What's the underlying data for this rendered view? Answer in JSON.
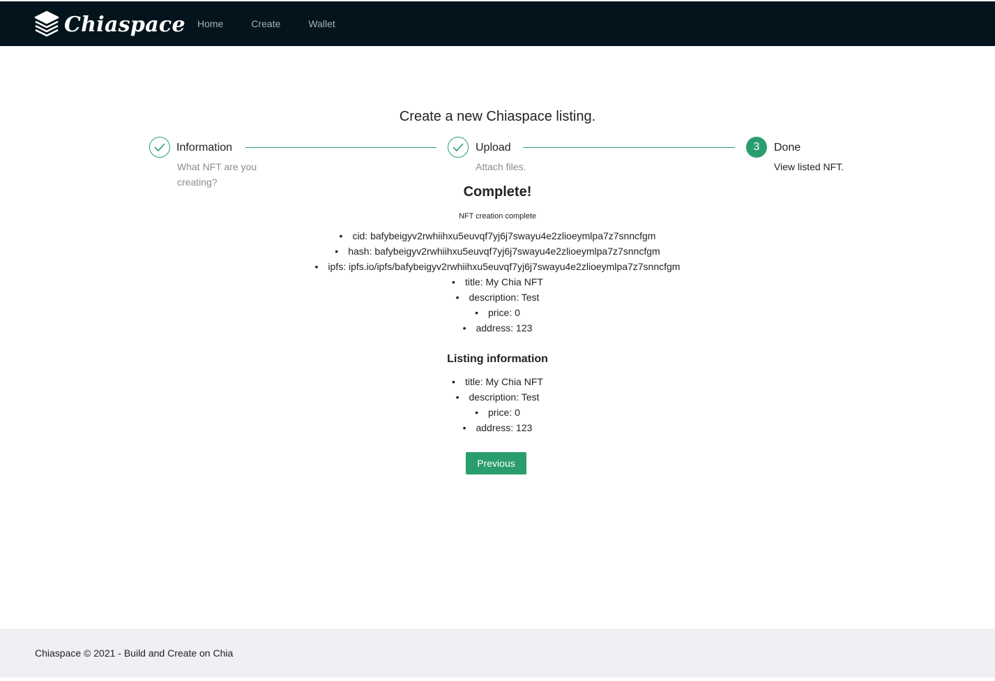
{
  "header": {
    "brand": "Chiaspace",
    "nav": [
      {
        "label": "Home"
      },
      {
        "label": "Create"
      },
      {
        "label": "Wallet"
      }
    ]
  },
  "main": {
    "title": "Create a new Chiaspace listing.",
    "steps": [
      {
        "title": "Information",
        "description": "What NFT are you creating?",
        "status": "done",
        "icon": "check-icon"
      },
      {
        "title": "Upload",
        "description": "Attach files.",
        "status": "done",
        "icon": "check-icon"
      },
      {
        "title": "Done",
        "description": "View listed NFT.",
        "status": "active",
        "number": "3"
      }
    ],
    "complete_title": "Complete!",
    "complete_subtitle": "NFT creation complete",
    "nft_details": [
      "cid: bafybeigyv2rwhiihxu5euvqf7yj6j7swayu4e2zlioeymlpa7z7snncfgm",
      "hash: bafybeigyv2rwhiihxu5euvqf7yj6j7swayu4e2zlioeymlpa7z7snncfgm",
      "ipfs: ipfs.io/ipfs/bafybeigyv2rwhiihxu5euvqf7yj6j7swayu4e2zlioeymlpa7z7snncfgm",
      "title: My Chia NFT",
      "description: Test",
      "price: 0",
      "address: 123"
    ],
    "listing_title": "Listing information",
    "listing_details": [
      "title: My Chia NFT",
      "description: Test",
      "price: 0",
      "address: 123"
    ],
    "previous_label": "Previous"
  },
  "footer": {
    "text": "Chiaspace © 2021 - Build and Create on Chia"
  },
  "colors": {
    "header_bg": "#03141c",
    "accent": "#2a9d6f",
    "footer_bg": "#eff0f3"
  }
}
